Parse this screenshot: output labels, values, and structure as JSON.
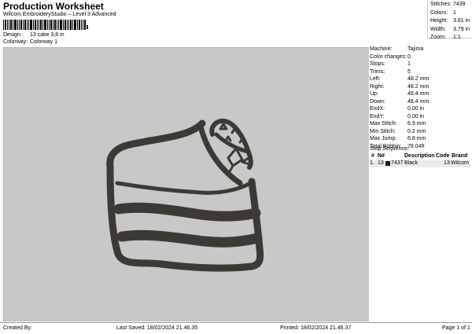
{
  "header": {
    "title": "Production Worksheet",
    "subtitle": "Wilcom EmbroideryStudio – Level 3 Advanced",
    "design_label": "Design:",
    "design_value": "13 cake 3,8 in",
    "colorway_label": "Colorway:",
    "colorway_value": "Colorway 1"
  },
  "top_stats": [
    {
      "label": "Stitches:",
      "value": "7439"
    },
    {
      "label": "Colors:",
      "value": "1"
    },
    {
      "label": "Height:",
      "value": "3.81 in"
    },
    {
      "label": "Width:",
      "value": "3.79 in"
    },
    {
      "label": "Zoom:",
      "value": "1:1"
    }
  ],
  "machine": [
    {
      "label": "Machine:",
      "value": "Tajima"
    },
    {
      "label": "Color changes:",
      "value": "0"
    },
    {
      "label": "Stops:",
      "value": "1"
    },
    {
      "label": "Trims:",
      "value": "5"
    },
    {
      "label": "Left:",
      "value": "48.2 mm"
    },
    {
      "label": "Right:",
      "value": "48.2 mm"
    },
    {
      "label": "Up:",
      "value": "48.4 mm"
    },
    {
      "label": "Down:",
      "value": "48.4 mm"
    },
    {
      "label": "EndX:",
      "value": "0.00 in"
    },
    {
      "label": "EndY:",
      "value": "0.00 in"
    },
    {
      "label": "Max Stitch:",
      "value": "6.9 mm"
    },
    {
      "label": "Min Stitch:",
      "value": "0.2 mm"
    },
    {
      "label": "Max Jump:",
      "value": "6.8 mm"
    },
    {
      "label": "Total Bobbin:",
      "value": "78.04ft"
    }
  ],
  "stop_sequence": {
    "title": "Stop Sequence:",
    "headers": [
      "#",
      "N#",
      "Description",
      "Code",
      "Brand"
    ],
    "rows": [
      {
        "num": "1.",
        "n": "13",
        "stitches": "7437",
        "description": "Black",
        "code": "13",
        "brand": "Wilcom",
        "color": "#1a1a1a"
      }
    ]
  },
  "footer": {
    "created_by": "Created By:",
    "last_saved": "Last Saved: 18/02/2024 21.46.35",
    "printed": "Printed: 18/02/2024 21.46.37",
    "page": "Page 1 of 1"
  },
  "colors": {
    "canvas_bg": "#c8c8c8",
    "thread": "#3d3a35"
  }
}
